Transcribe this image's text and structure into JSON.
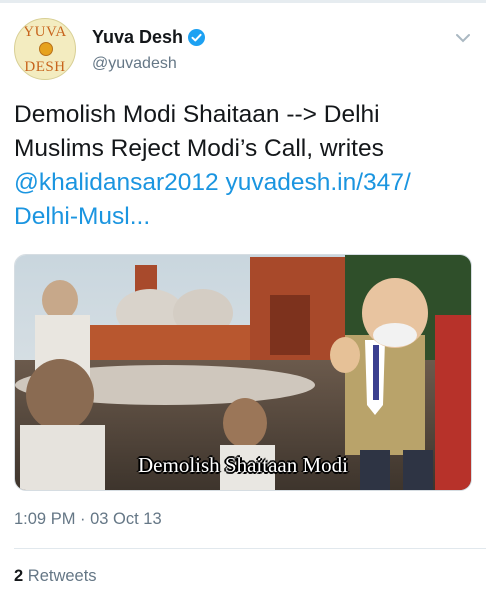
{
  "author": {
    "avatar_text_top": "YUVA",
    "avatar_text_bottom": "DESH",
    "display_name": "Yuva Desh",
    "handle": "@yuvadesh",
    "verified": true
  },
  "tweet": {
    "text_line1": "Demolish Modi Shaitaan --> Delhi",
    "text_line2": "Muslims Reject Modi’s Call, writes",
    "mention": "@khalidansar2012",
    "link_part1": "yuvadesh.in/347/",
    "link_part2": "Delhi-Musl...",
    "media_caption": "Demolish Shaitaan Modi",
    "timestamp": "1:09 PM · 03 Oct 13"
  },
  "stats": {
    "retweet_count": "2",
    "retweet_label": "Retweets"
  },
  "colors": {
    "link": "#1b95e0",
    "verified": "#1da1f2",
    "secondary_text": "#657786"
  },
  "icons": [
    "verified-icon",
    "chevron-down-icon"
  ]
}
